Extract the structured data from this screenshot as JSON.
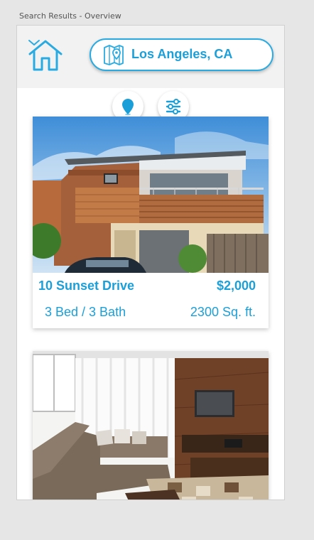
{
  "artboard": {
    "title": "Search Results - Overview"
  },
  "header": {
    "home_icon": "home-icon",
    "dropdown_icon": "chevron-down-icon",
    "location": {
      "icon": "map-pin-icon",
      "label": "Los Angeles, CA"
    }
  },
  "actions": [
    {
      "name": "map-view-button",
      "icon": "location-pin-icon"
    },
    {
      "name": "filter-button",
      "icon": "sliders-icon"
    }
  ],
  "listings": [
    {
      "address": "10 Sunset Drive",
      "price": "$2,000",
      "beds_baths": "3 Bed / 3 Bath",
      "area": "2300 Sq. ft.",
      "photo": "modern-house-exterior"
    },
    {
      "photo": "living-room-interior"
    }
  ],
  "colors": {
    "accent": "#29abe2",
    "text_accent": "#1b9fd9",
    "header_bg": "#f2f2f2"
  }
}
